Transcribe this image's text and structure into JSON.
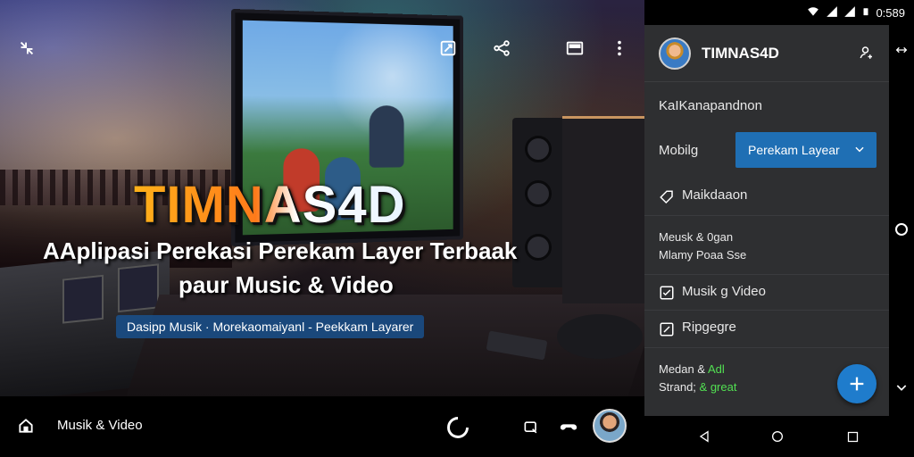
{
  "hero": {
    "title": "TIMNAS4D",
    "subtitle_line1": "AAplipasi Perekasi Perekam Layer Terbaak",
    "subtitle_line2": "paur Music & Video",
    "tagline": "Dasipp Musik · Morekaomaiyanl - Peekkam Layarer"
  },
  "bottom_bar": {
    "label": "Musik & Video"
  },
  "status_bar": {
    "time": "0:589"
  },
  "panel": {
    "title": "TIMNAS4D",
    "section_label": "KaIKanapandnon",
    "mobile_label": "Mobilg",
    "dropdown_value": "Perekam Layear",
    "item1": "Maikdaaon",
    "item2_line1": "Meusk & 0gan",
    "item2_line2": "Mlamy Poaa Sse",
    "item3": "Musik g Video",
    "item4": "Ripgegre",
    "item5_line1_a": "Medan &",
    "item5_line1_b": "Adl",
    "item5_line2_a": "Strand;",
    "item5_line2_b": "& great"
  },
  "colors": {
    "accent": "#1f7ccc",
    "panel_bg": "#2e2f31",
    "title_orange": "#ffb21a",
    "green_text": "#52e052"
  },
  "icons": {
    "overlay": [
      "collapse-icon",
      "cast-edit-icon",
      "share-icon",
      "miniplayer-icon",
      "more-vert-icon"
    ],
    "bottom": [
      "home-icon",
      "loading-icon",
      "flag-icon",
      "gamepad-icon"
    ],
    "nav": [
      "back-icon",
      "home-nav-icon",
      "recents-icon"
    ]
  }
}
